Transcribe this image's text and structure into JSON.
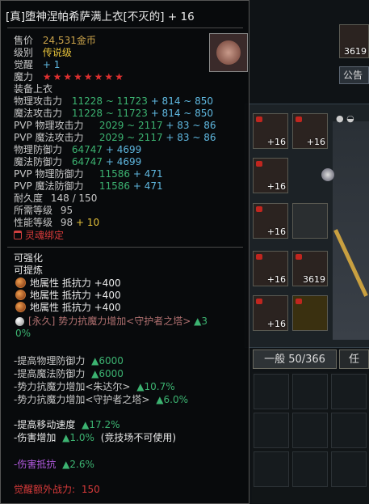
{
  "background": {
    "tab_label": "公告",
    "inventory_tab": "一般 50/366",
    "inventory_tab2": "任",
    "top_icon_count": "3619",
    "slot_counts": [
      "+16",
      "+16",
      "+16",
      "+16",
      "+16",
      "+16",
      "3619"
    ]
  },
  "tooltip": {
    "title_main": "[真]堕神涅帕希萨满上衣[不灭的]",
    "title_plus": "+ 16",
    "price_label": "售价",
    "price_value": "24,531金币",
    "grade_label": "级别",
    "grade_value": "传说级",
    "awaken_label": "觉醒",
    "awaken_value": "+ 1",
    "magic_label": "魔力",
    "magic_stars": "★★★★★★★★",
    "slot_label": "装备上衣",
    "stats": [
      {
        "label": "物理攻击力",
        "base": "11228 ~ 11723",
        "bonus": "+ 814 ~ 850"
      },
      {
        "label": "魔法攻击力",
        "base": "11228 ~ 11723",
        "bonus": "+ 814 ~ 850"
      },
      {
        "label": "PVP 物理攻击力",
        "base": "2029 ~ 2117",
        "bonus": "+ 83 ~ 86"
      },
      {
        "label": "PVP 魔法攻击力",
        "base": "2029 ~ 2117",
        "bonus": "+ 83 ~ 86"
      },
      {
        "label": "物理防御力",
        "base": "64747",
        "bonus": "+ 4699"
      },
      {
        "label": "魔法防御力",
        "base": "64747",
        "bonus": "+ 4699"
      },
      {
        "label": "PVP 物理防御力",
        "base": "11586",
        "bonus": "+ 471"
      },
      {
        "label": "PVP 魔法防御力",
        "base": "11586",
        "bonus": "+ 471"
      }
    ],
    "durability_label": "耐久度",
    "durability_value": "148 / 150",
    "req_level_label": "所需等级",
    "req_level_value": "95",
    "perf_label": "性能等级",
    "perf_value": "98",
    "perf_bonus": "+ 10",
    "soulbound": "灵魂绑定",
    "enhanceable": "可强化",
    "refinable": "可提炼",
    "resist_lines": [
      "地属性 抵抗力 +400",
      "地属性 抵抗力 +400",
      "地属性 抵抗力 +400"
    ],
    "permanent_line_prefix": "[永久]",
    "permanent_line_text": "势力抗魔力增加<守护者之塔>",
    "permanent_line_value": "▲3",
    "permanent_line_value2": "0%",
    "bonus_lines": [
      {
        "text": "-提高物理防御力",
        "value": "▲6000"
      },
      {
        "text": "-提高魔法防御力",
        "value": "▲6000"
      },
      {
        "text": "-势力抗魔力增加<朱达尔>",
        "value": "▲10.7%"
      },
      {
        "text": "-势力抗魔力增加<守护者之塔>",
        "value": "▲6.0%"
      }
    ],
    "move_speed_text": "-提高移动速度",
    "move_speed_value": "▲17.2%",
    "dmg_inc_text": "-伤害增加",
    "dmg_inc_value": "▲1.0%",
    "dmg_inc_note": "(竞技场不可使用)",
    "dmg_resist_text": "-伤害抵抗",
    "dmg_resist_value": "▲2.6%",
    "awaken_power_label": "觉醒额外战力:",
    "awaken_power_value": "150"
  }
}
